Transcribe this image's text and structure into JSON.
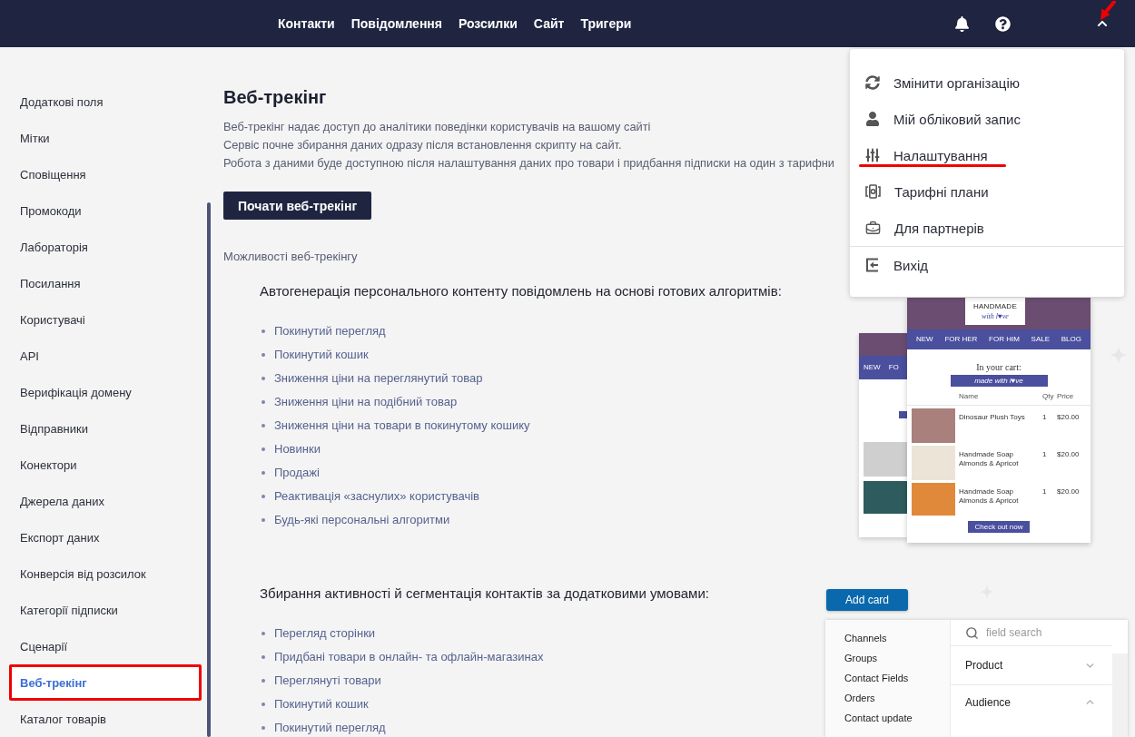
{
  "top_bar": {
    "nav": [
      {
        "label": "Контакти"
      },
      {
        "label": "Повідомлення"
      },
      {
        "label": "Розсилки"
      },
      {
        "label": "Сайт"
      },
      {
        "label": "Тригери"
      }
    ],
    "account_menu": {
      "expanded": true,
      "marked": true,
      "groups": [
        [
          {
            "label": "Змінити організацію",
            "marked": false
          },
          {
            "label": "Мій обліковий запис",
            "marked": false
          },
          {
            "label": "Налаштування",
            "marked": true
          },
          {
            "label": "Тарифні плани",
            "marked": false
          },
          {
            "label": "Для партнерів",
            "marked": false
          }
        ],
        [
          {
            "label": "Вихід",
            "marked": false
          }
        ]
      ]
    }
  },
  "sidebar": {
    "items": [
      {
        "label": "Додаткові поля",
        "selected": false,
        "marked": false
      },
      {
        "label": "Мітки",
        "selected": false,
        "marked": false
      },
      {
        "label": "Сповіщення",
        "selected": false,
        "marked": false
      },
      {
        "label": "Промокоди",
        "selected": false,
        "marked": false
      },
      {
        "label": "Лабораторія",
        "selected": false,
        "marked": false
      },
      {
        "label": "Посилання",
        "selected": false,
        "marked": false
      },
      {
        "label": "Користувачі",
        "selected": false,
        "marked": false
      },
      {
        "label": "API",
        "selected": false,
        "marked": false
      },
      {
        "label": "Верифікація домену",
        "selected": false,
        "marked": false
      },
      {
        "label": "Відправники",
        "selected": false,
        "marked": false
      },
      {
        "label": "Конектори",
        "selected": false,
        "marked": false
      },
      {
        "label": "Джерела даних",
        "selected": false,
        "marked": false
      },
      {
        "label": "Експорт даних",
        "selected": false,
        "marked": false
      },
      {
        "label": "Конверсія від розсилок",
        "selected": false,
        "marked": false
      },
      {
        "label": "Категорії підписки",
        "selected": false,
        "marked": false
      },
      {
        "label": "Сценарії",
        "selected": false,
        "marked": false
      },
      {
        "label": "Веб-трекінг",
        "selected": true,
        "marked": true
      },
      {
        "label": "Каталог товарів",
        "selected": false,
        "marked": false
      }
    ]
  },
  "main": {
    "title": "Веб-трекінг",
    "description": [
      "Веб-трекінг надає доступ до аналітики поведінки користувачів на вашому сайті",
      "Сервіс почне збирання даних одразу після встановлення скрипту на сайт.",
      "Робота з даними буде доступною після налаштування даних про товари і придбання підписки на один з тарифни"
    ],
    "start_button": "Почати веб-трекінг",
    "subtitle": "Можливості веб-трекінгу",
    "sections": [
      {
        "heading": "Автогенерація персонального контенту повідомлень на основі готових алгоритмів:",
        "items": [
          "Покинутий перегляд",
          "Покинутий кошик",
          "Зниження ціни на переглянутий товар",
          "Зниження ціни на подібний товар",
          "Зниження ціни на товари в покинутому кошику",
          "Новинки",
          "Продажі",
          "Реактивація «заснулих» користувачів",
          "Будь-які персональні алгоритми"
        ],
        "illustration": {
          "kind": "email_preview",
          "back_nav": [
            "NEW",
            "FO"
          ],
          "logo": {
            "title": "HANDMADE",
            "tagline": "with l♥ve"
          },
          "nav": [
            "NEW",
            "FOR HER",
            "FOR HIM",
            "SALE",
            "BLOG"
          ],
          "cart_title": "In your cart:",
          "ribbon": "made with l♥ve",
          "columns": [
            "Name",
            "Qty",
            "Price"
          ],
          "rows": [
            {
              "name": "Dinosaur Plush Toys",
              "qty": "1",
              "price": "$20.00"
            },
            {
              "name": "Handmade Soap Almonds & Apricot",
              "qty": "1",
              "price": "$20.00"
            },
            {
              "name": "Handmade Soap Almonds & Apricot",
              "qty": "1",
              "price": "$20.00"
            }
          ],
          "button": "Check out now"
        }
      },
      {
        "heading": "Збирання активності й сегментація контактів за додатковими умовами:",
        "items": [
          "Перегляд сторінки",
          "Придбані товари в онлайн- та офлайн-магазинах",
          "Переглянуті товари",
          "Покинутий кошик",
          "Покинутий перегляд"
        ],
        "illustration": {
          "kind": "card_builder",
          "button": "Add card",
          "categories": [
            "Channels",
            "Groups",
            "Contact Fields",
            "Orders",
            "Contact update"
          ],
          "search": {
            "placeholder": "field search"
          },
          "groups": [
            {
              "label": "Product",
              "expanded": false
            },
            {
              "label": "Audience",
              "expanded": true
            }
          ]
        }
      }
    ]
  }
}
